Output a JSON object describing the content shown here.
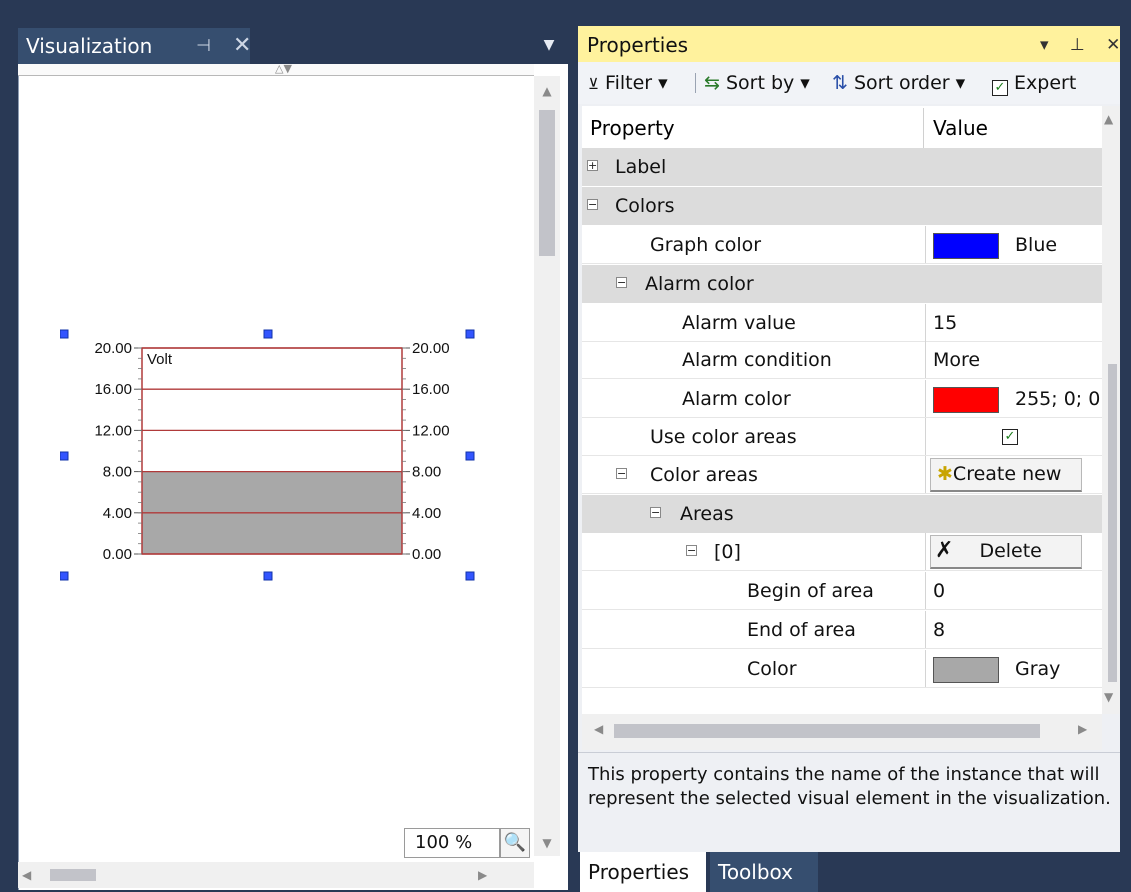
{
  "visualization": {
    "tab_title": "Visualization",
    "pin_glyph": "⊣",
    "close_glyph": "✕",
    "dropdown_glyph": "▼",
    "zoom_label": "100 %",
    "zoom_icon": "🔍",
    "meter": {
      "left_ticks": [
        "20.00",
        "16.00",
        "12.00",
        "8.00",
        "4.00",
        "0.00"
      ],
      "right_ticks": [
        "20.00",
        "16.00",
        "12.00",
        "8.00",
        "4.00",
        "0.00"
      ],
      "unit_label": "Volt",
      "range": [
        0,
        20
      ],
      "gray_area": [
        0,
        8
      ],
      "line_color": "#b03a3a",
      "area_color": "#a8a8a8",
      "handle_color": "#3355ff"
    }
  },
  "properties": {
    "title": "Properties",
    "header_controls": "▾ ⊥ ✕",
    "toolbar": {
      "filter": "Filter ▾",
      "sort_by": "Sort by ▾",
      "sort_order": "Sort order ▾",
      "expert": "Expert",
      "expert_checked": true
    },
    "columns": {
      "property": "Property",
      "value": "Value"
    },
    "rows": [
      {
        "label": "Label",
        "expander": "+",
        "category": true
      },
      {
        "label": "Colors",
        "expander": "−",
        "category": true
      },
      {
        "label": "Graph color",
        "swatch": "#0000ff",
        "value": "Blue"
      },
      {
        "label": "Alarm color",
        "expander": "−",
        "category": true
      },
      {
        "label": "Alarm value",
        "value": "15"
      },
      {
        "label": "Alarm condition",
        "value": "More"
      },
      {
        "label": "Alarm color",
        "swatch": "#ff0000",
        "value": "255; 0; 0"
      },
      {
        "label": "Use color areas",
        "checkbox": true
      },
      {
        "label": "Color areas",
        "expander": "−",
        "button": "Create new"
      },
      {
        "label": "Areas",
        "expander": "−",
        "category": true
      },
      {
        "label": "[0]",
        "expander": "−",
        "button": "Delete"
      },
      {
        "label": "Begin of area",
        "value": "0"
      },
      {
        "label": "End of area",
        "value": "8"
      },
      {
        "label": "Color",
        "swatch": "#a8a8a8",
        "value": "Gray"
      }
    ],
    "description": "This property contains the name of the instance that will represent the selected visual element in the visualization.",
    "bottom_tabs": {
      "properties": "Properties",
      "toolbox": "Toolbox"
    }
  }
}
